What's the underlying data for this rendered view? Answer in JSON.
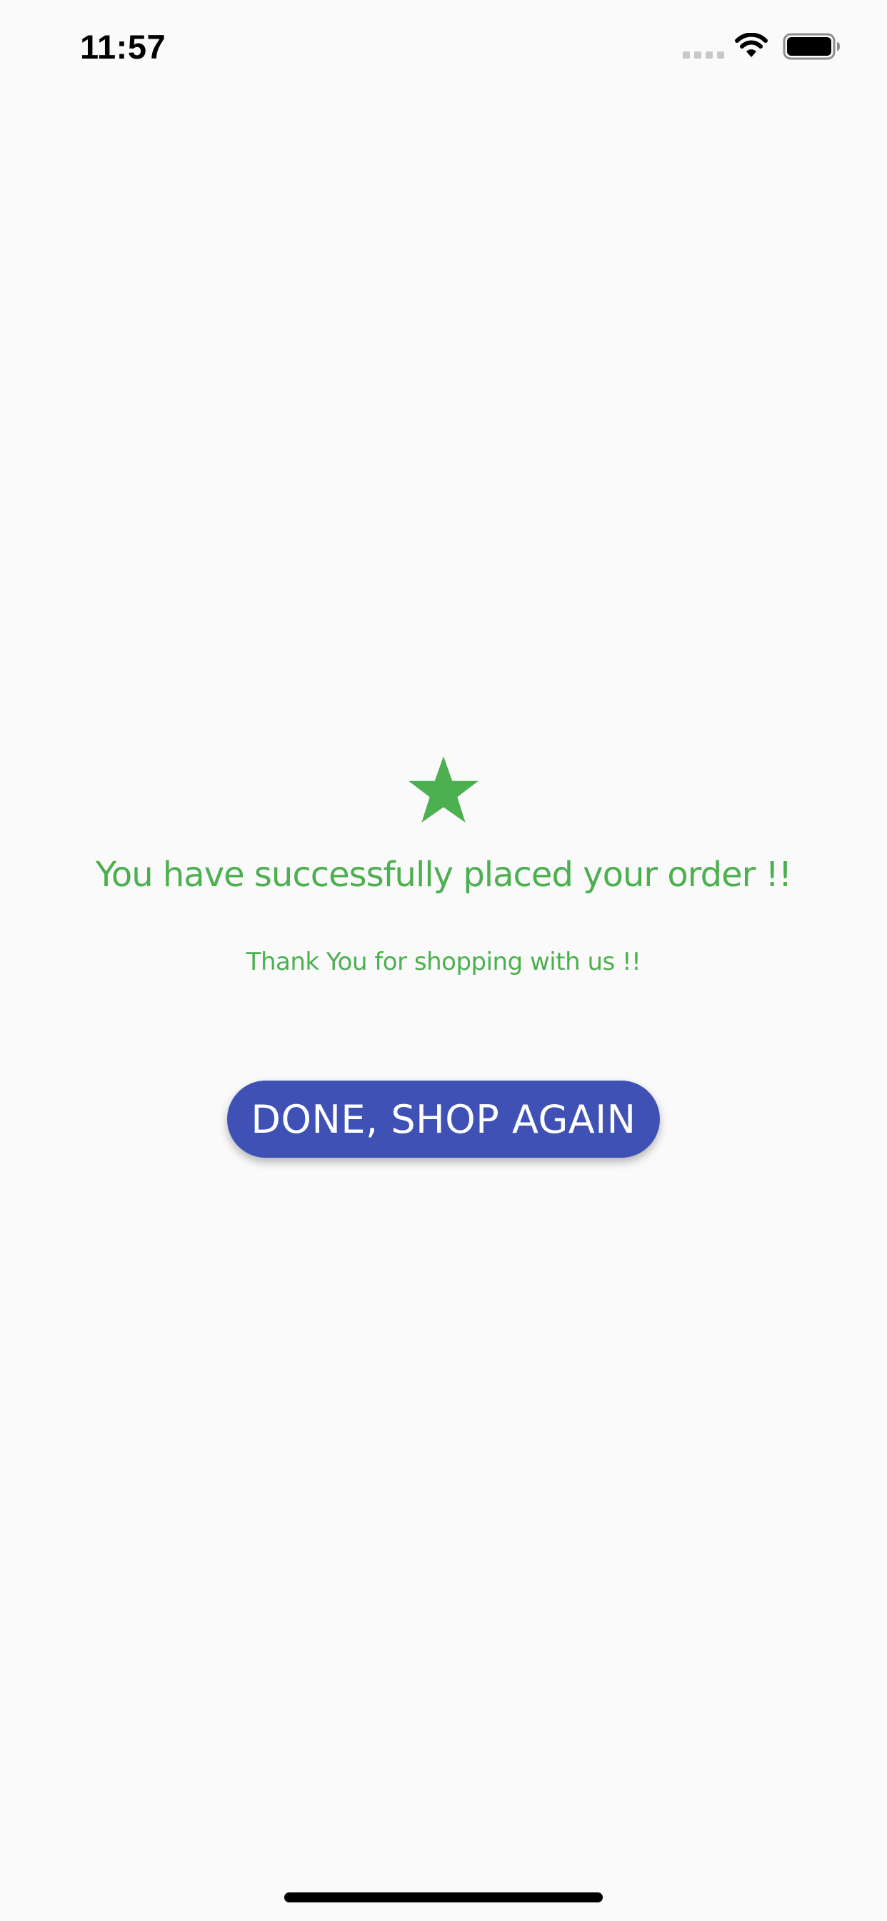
{
  "status_bar": {
    "time": "11:57",
    "signal_icon": "cellular-signal-icon",
    "wifi_icon": "wifi-icon",
    "battery_icon": "battery-icon"
  },
  "confirmation": {
    "icon": "star-icon",
    "icon_color": "#4caf50",
    "title": "You have successfully placed your order !!",
    "subtitle": "Thank You for shopping with us !!",
    "text_color": "#4caf50"
  },
  "actions": {
    "done_label": "DONE, SHOP AGAIN",
    "button_color": "#3f51b5"
  }
}
